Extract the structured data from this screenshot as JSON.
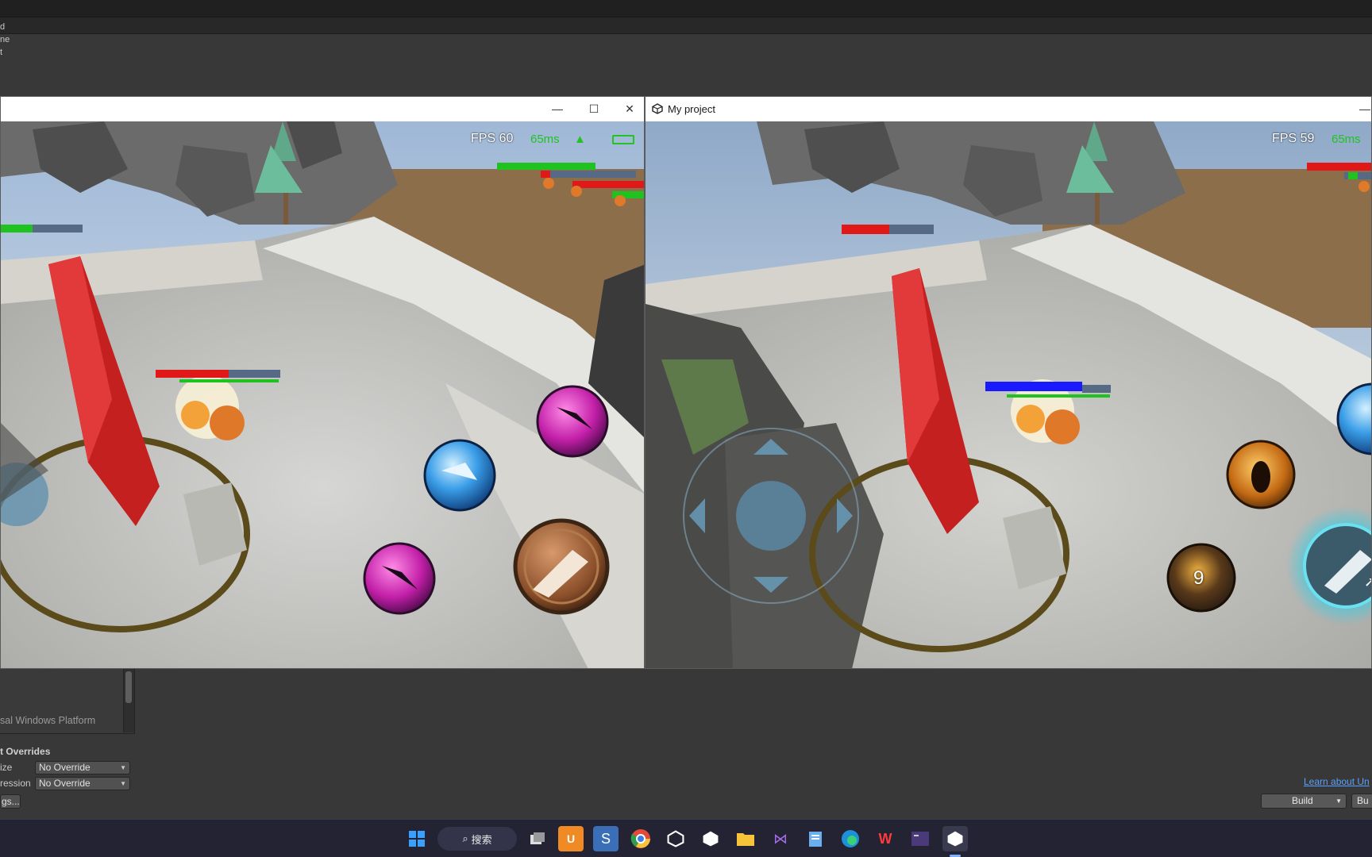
{
  "editor": {
    "left_labels": [
      "d",
      "ne",
      "t"
    ],
    "platform_item": "sal Windows Platform",
    "overrides_title": "t Overrides",
    "fields": [
      {
        "label": "ize",
        "value": "No Override"
      },
      {
        "label": "ression",
        "value": "No Override"
      }
    ],
    "settings_button": "gs...",
    "learn_link": "Learn about Un",
    "build_label": "Build",
    "build2_label": "Bu"
  },
  "left_window": {
    "title": "",
    "fps": "FPS 60",
    "ping": "65ms",
    "controls": {
      "minimize": "—",
      "maximize": "☐",
      "close": "✕"
    }
  },
  "right_window": {
    "title": "My project",
    "fps": "FPS 59",
    "ping": "65ms",
    "controls": {
      "minimize": "—"
    },
    "skill_cooldown": "9"
  },
  "taskbar": {
    "search_label": "搜索",
    "apps": [
      "windows-start",
      "search",
      "task-view",
      "ui-app",
      "sublime",
      "chrome",
      "unity-hub",
      "unity",
      "file-explorer",
      "visual-studio",
      "notepad",
      "edge",
      "wps",
      "terminal",
      "unity-active"
    ]
  },
  "colors": {
    "hp_red": "#e01818",
    "hp_green": "#1fc21f",
    "mana_blue": "#1a1aff",
    "ping_green": "#22c322"
  }
}
